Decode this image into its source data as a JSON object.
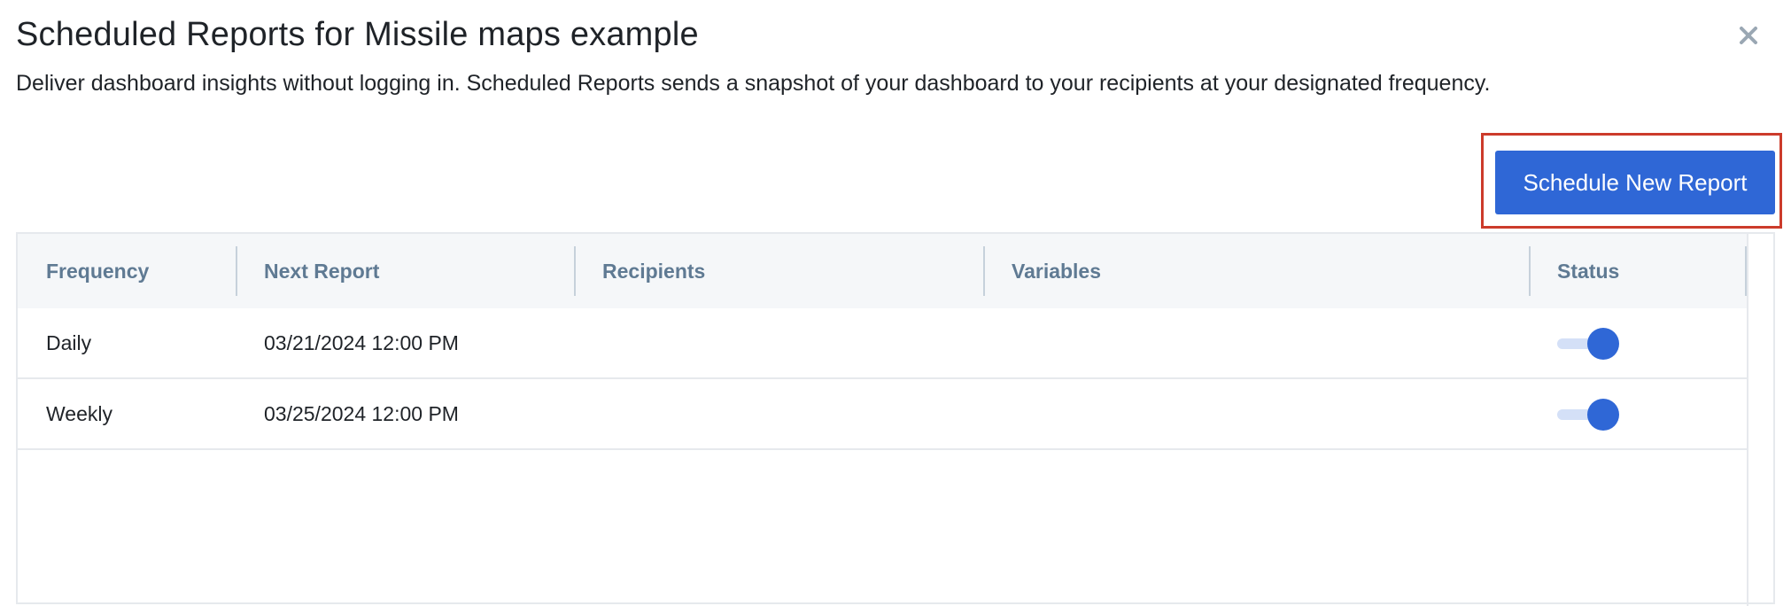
{
  "modal": {
    "title": "Scheduled Reports for Missile maps example",
    "description": "Deliver dashboard insights without logging in. Scheduled Reports sends a snapshot of your dashboard to your recipients at your designated frequency.",
    "close_icon": "close-icon"
  },
  "actions": {
    "schedule_new_report_label": "Schedule New Report",
    "accent_color": "#2f67d6",
    "highlight_color": "#cc3b2b"
  },
  "table": {
    "headers": {
      "frequency": "Frequency",
      "next_report": "Next Report",
      "recipients": "Recipients",
      "variables": "Variables",
      "status": "Status"
    },
    "rows": [
      {
        "frequency": "Daily",
        "next_report": "03/21/2024 12:00 PM",
        "recipients": "",
        "variables": "",
        "status_enabled": true
      },
      {
        "frequency": "Weekly",
        "next_report": "03/25/2024 12:00 PM",
        "recipients": "",
        "variables": "",
        "status_enabled": true
      }
    ]
  }
}
